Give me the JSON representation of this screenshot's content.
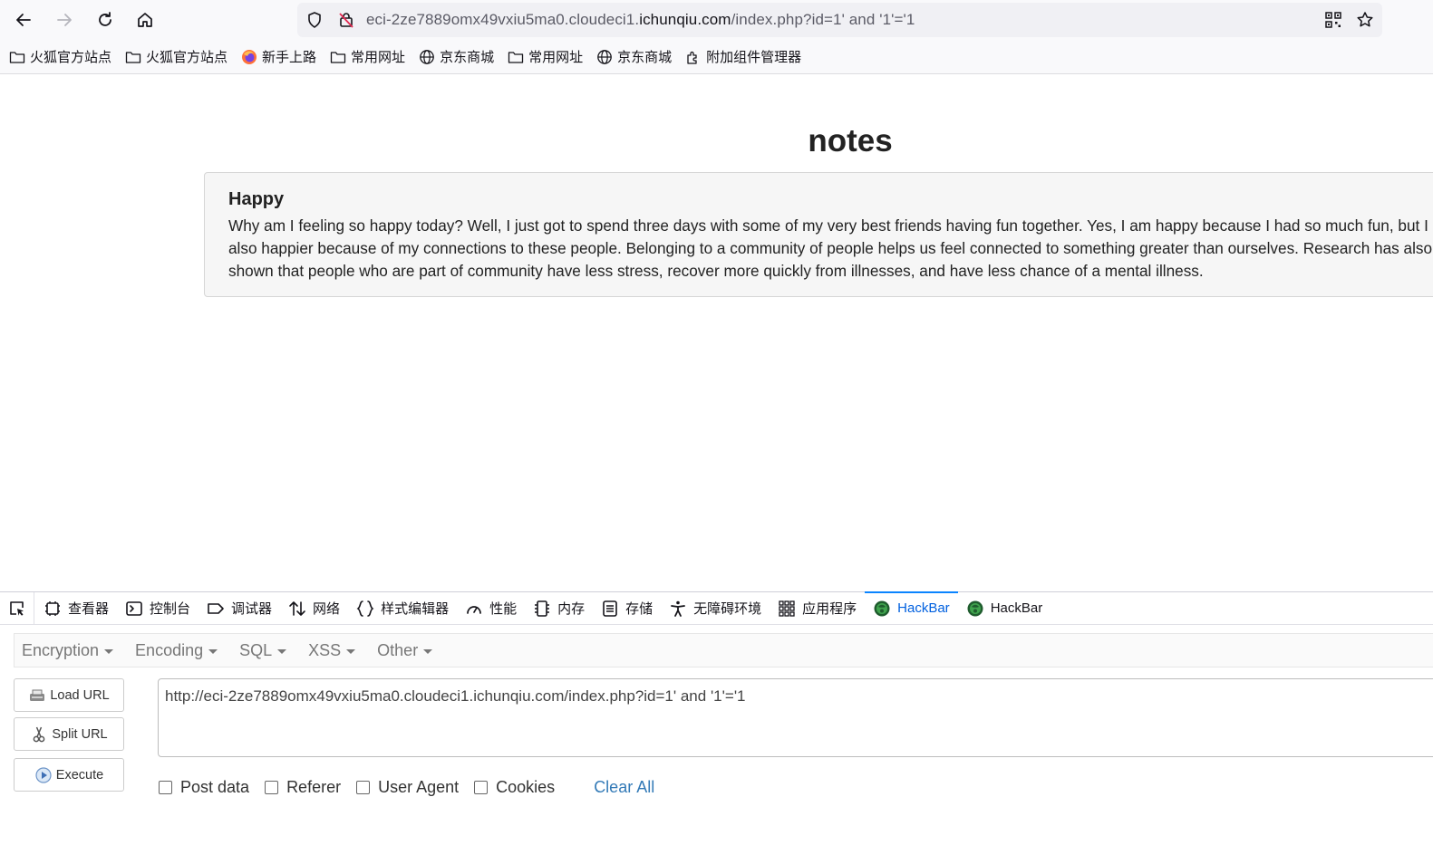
{
  "browser": {
    "url": {
      "prefix": "eci-2ze7889omx49vxiu5ma0.cloudeci1.",
      "domain": "ichunqiu.com",
      "suffix": "/index.php?id=1' and '1'='1"
    },
    "bookmarks": [
      {
        "label": "火狐官方站点",
        "icon": "folder-icon"
      },
      {
        "label": "火狐官方站点",
        "icon": "folder-icon"
      },
      {
        "label": "新手上路",
        "icon": "firefox-icon"
      },
      {
        "label": "常用网址",
        "icon": "folder-icon"
      },
      {
        "label": "京东商城",
        "icon": "globe-icon"
      },
      {
        "label": "常用网址",
        "icon": "folder-icon"
      },
      {
        "label": "京东商城",
        "icon": "globe-icon"
      },
      {
        "label": "附加组件管理器",
        "icon": "puzzle-icon"
      }
    ]
  },
  "page": {
    "title": "notes",
    "note": {
      "title": "Happy",
      "lines": [
        "Why am I feeling so happy today? Well, I just got to spend three days with some of my very best friends having fun together. Yes, I am happy because I had so much fun, but I am",
        "also happier because of my connections to these people. Belonging to a community of people helps us feel connected to something greater than ourselves. Research has also",
        "shown that people who are part of community have less stress, recover more quickly from illnesses, and have less chance of a mental illness."
      ]
    }
  },
  "devtools": {
    "tabs": [
      {
        "label": "查看器",
        "icon": "inspector-icon"
      },
      {
        "label": "控制台",
        "icon": "console-icon"
      },
      {
        "label": "调试器",
        "icon": "debugger-icon"
      },
      {
        "label": "网络",
        "icon": "network-icon"
      },
      {
        "label": "样式编辑器",
        "icon": "style-editor-icon"
      },
      {
        "label": "性能",
        "icon": "performance-icon"
      },
      {
        "label": "内存",
        "icon": "memory-icon"
      },
      {
        "label": "存储",
        "icon": "storage-icon"
      },
      {
        "label": "无障碍环境",
        "icon": "accessibility-icon"
      },
      {
        "label": "应用程序",
        "icon": "application-icon"
      },
      {
        "label": "HackBar",
        "icon": "hackbar-icon",
        "active": true
      },
      {
        "label": "HackBar",
        "icon": "hackbar-icon"
      }
    ],
    "active_color": "#0060df"
  },
  "hackbar": {
    "menu": [
      "Encryption",
      "Encoding",
      "SQL",
      "XSS",
      "Other"
    ],
    "load_url": "Load URL",
    "split_url": "Split URL",
    "execute": "Execute",
    "url_value": "http://eci-2ze7889omx49vxiu5ma0.cloudeci1.ichunqiu.com/index.php?id=1' and '1'='1",
    "options": [
      "Post data",
      "Referer",
      "User Agent",
      "Cookies"
    ],
    "clear_all": "Clear All",
    "link_color": "#337ab7"
  }
}
